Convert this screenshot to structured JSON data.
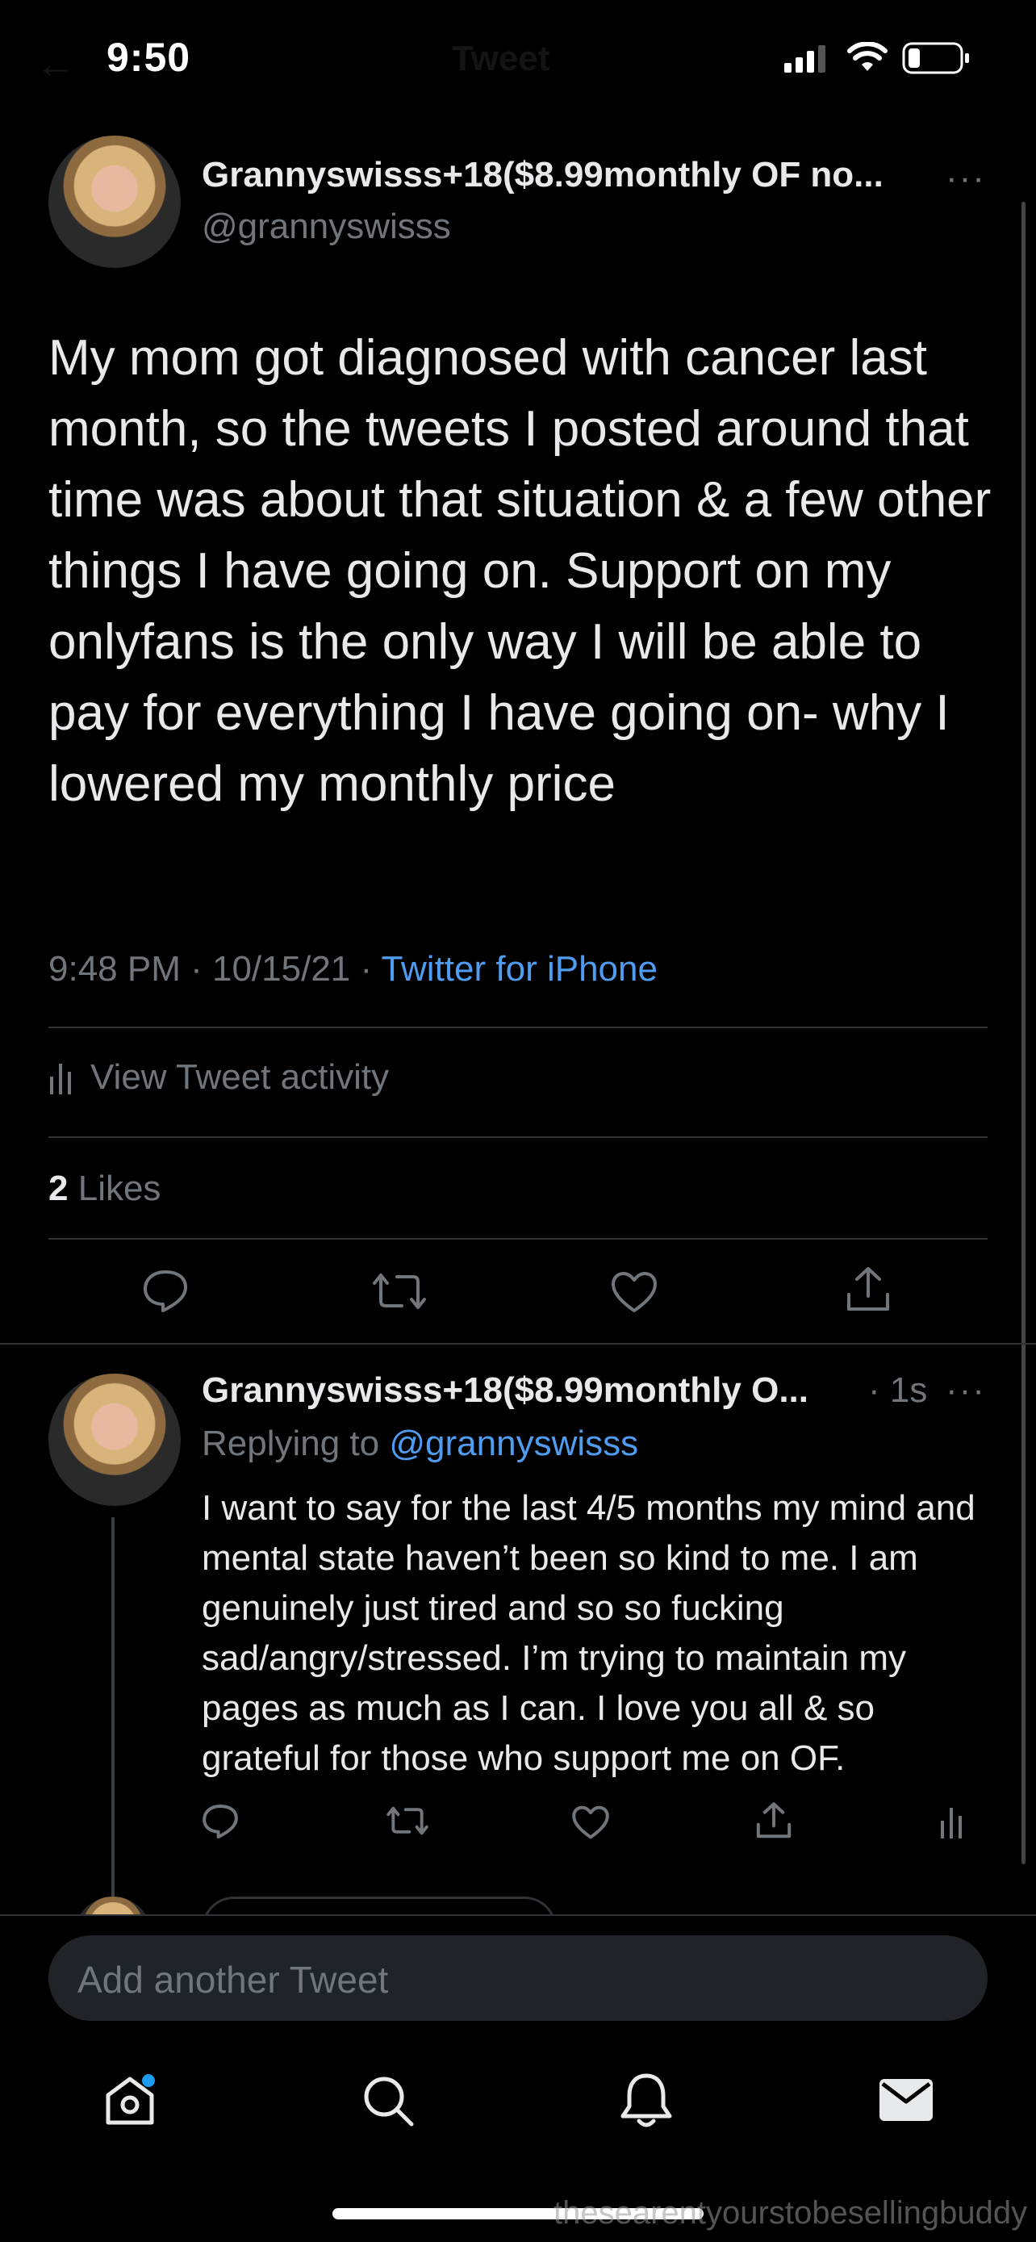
{
  "status_bar": {
    "time": "9:50"
  },
  "header": {
    "title": "Tweet"
  },
  "tweet": {
    "author_name": "Grannyswisss+18($8.99monthly OF no...",
    "handle": "@grannyswisss",
    "text": "My mom got diagnosed with cancer last month, so the tweets I posted around that time was about that situation & a few other things I have going on. Support on my onlyfans is the only way I will be able to pay for everything I have going on- why I lowered my monthly price",
    "time": "9:48 PM",
    "date": "10/15/21",
    "source": "Twitter for iPhone",
    "activity_label": "View Tweet activity",
    "likes_count": "2",
    "likes_label": "Likes"
  },
  "reply": {
    "author_name": "Grannyswisss+18($8.99monthly O...",
    "age": "1s",
    "replying_prefix": "Replying to",
    "replying_handle": "@grannyswisss",
    "text": "I want to say for the last 4/5 months my mind and mental state haven’t been so kind to me. I am genuinely just tired and so so fucking sad/angry/stressed. I’m trying to maintain my pages as much as I can. I love you all & so grateful for those who support me on OF."
  },
  "compose": {
    "placeholder": "Add another Tweet"
  },
  "tabbar": [
    "home-icon",
    "search-icon",
    "notifications-icon",
    "messages-icon"
  ],
  "colors": {
    "accent": "#4f9cf0",
    "background": "#000000",
    "muted": "#71767b"
  },
  "watermark": "thesearentyourstobesellingbuddy"
}
